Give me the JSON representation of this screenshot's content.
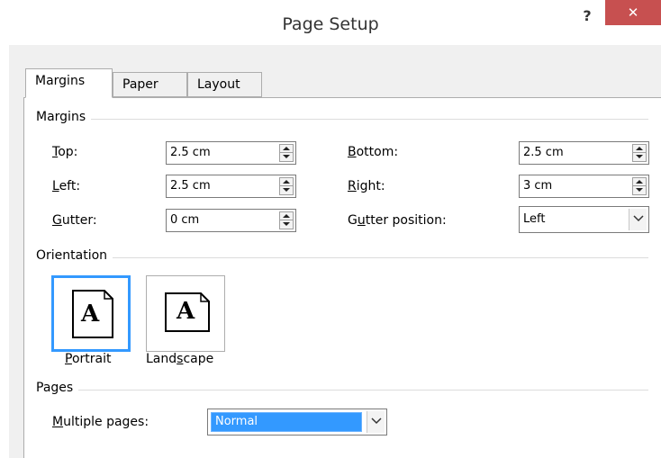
{
  "window": {
    "title": "Page Setup",
    "help": "?",
    "close": "✕"
  },
  "tabs": [
    {
      "label": "Margins",
      "active": true
    },
    {
      "label": "Paper",
      "active": false
    },
    {
      "label": "Layout",
      "active": false
    }
  ],
  "margins": {
    "section": "Margins",
    "top": {
      "label_u": "T",
      "label_rest": "op:",
      "value": "2.5 cm"
    },
    "left": {
      "label_u": "L",
      "label_rest": "eft:",
      "value": "2.5 cm"
    },
    "gutter": {
      "label_u": "G",
      "label_rest": "utter:",
      "value": "0 cm"
    },
    "bottom": {
      "label_u": "B",
      "label_rest": "ottom:",
      "value": "2.5 cm"
    },
    "right": {
      "label_u": "R",
      "label_rest": "ight:",
      "value": "3 cm"
    },
    "gutter_position": {
      "label_pre": "G",
      "label_u": "u",
      "label_rest": "tter position:",
      "value": "Left"
    }
  },
  "orientation": {
    "section": "Orientation",
    "glyph": "A",
    "portrait": {
      "label_u": "P",
      "label_rest": "ortrait",
      "selected": true
    },
    "landscape": {
      "label_pre": "Land",
      "label_u": "s",
      "label_rest": "cape",
      "selected": false
    }
  },
  "pages": {
    "section": "Pages",
    "multiple_pages": {
      "label_u": "M",
      "label_rest": "ultiple pages:",
      "value": "Normal"
    }
  },
  "colors": {
    "accent": "#3399ff",
    "close_bg": "#c75050"
  }
}
